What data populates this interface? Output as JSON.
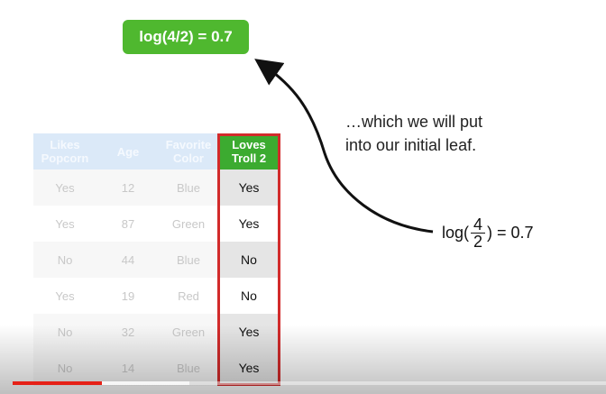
{
  "slide": {
    "result_badge": "log(4/2) = 0.7",
    "note_line1": "…which we will put",
    "note_line2": "into our initial leaf.",
    "formula": {
      "prefix": "log(",
      "numerator": "4",
      "denominator": "2",
      "suffix": ") = 0.7"
    },
    "table": {
      "headers": {
        "popcorn": [
          "Likes",
          "Popcorn"
        ],
        "age": "Age",
        "color": [
          "Favorite",
          "Color"
        ],
        "loves": [
          "Loves",
          "Troll 2"
        ]
      },
      "rows": [
        {
          "popcorn": "Yes",
          "age": "12",
          "color": "Blue",
          "loves": "Yes"
        },
        {
          "popcorn": "Yes",
          "age": "87",
          "color": "Green",
          "loves": "Yes"
        },
        {
          "popcorn": "No",
          "age": "44",
          "color": "Blue",
          "loves": "No"
        },
        {
          "popcorn": "Yes",
          "age": "19",
          "color": "Red",
          "loves": "No"
        },
        {
          "popcorn": "No",
          "age": "32",
          "color": "Green",
          "loves": "Yes"
        },
        {
          "popcorn": "No",
          "age": "14",
          "color": "Blue",
          "loves": "Yes"
        }
      ]
    }
  },
  "player": {
    "progress_played": 0.15,
    "progress_buffered": 0.3
  },
  "colors": {
    "badge": "#4fb82f",
    "loves_header": "#3cab30",
    "highlight_border": "#d22b2b",
    "faded_header": "#dbe9f8",
    "progress": "#e62117"
  }
}
